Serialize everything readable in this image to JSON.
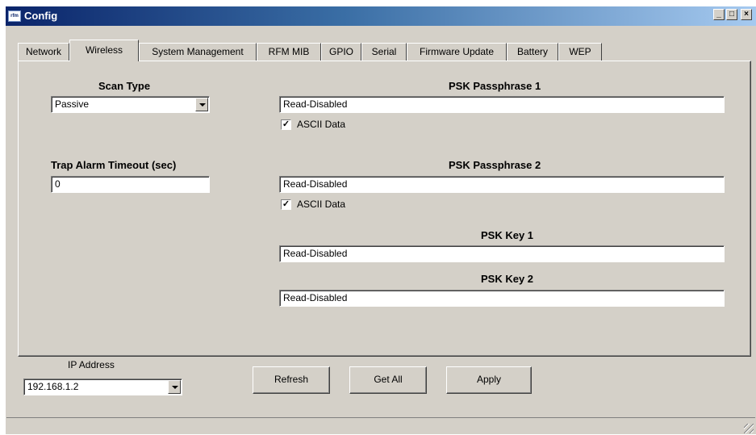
{
  "window": {
    "title": "Config",
    "icon_text": "rfm",
    "minimize_glyph": "_",
    "maximize_glyph": "□",
    "close_glyph": "×"
  },
  "tabs": [
    {
      "label": "Network",
      "active": false
    },
    {
      "label": "Wireless",
      "active": true
    },
    {
      "label": "System Management",
      "active": false
    },
    {
      "label": "RFM MIB",
      "active": false
    },
    {
      "label": "GPIO",
      "active": false
    },
    {
      "label": "Serial",
      "active": false
    },
    {
      "label": "Firmware Update",
      "active": false
    },
    {
      "label": "Battery",
      "active": false
    },
    {
      "label": "WEP",
      "active": false
    }
  ],
  "wireless": {
    "scan_type_label": "Scan Type",
    "scan_type_value": "Passive",
    "trap_alarm_label": "Trap Alarm Timeout (sec)",
    "trap_alarm_value": "0",
    "psk_passphrase_1_label": "PSK Passphrase 1",
    "psk_passphrase_1_value": "Read-Disabled",
    "ascii_data_1_label": "ASCII Data",
    "ascii_data_1_checked": true,
    "psk_passphrase_2_label": "PSK Passphrase 2",
    "psk_passphrase_2_value": "Read-Disabled",
    "ascii_data_2_label": "ASCII Data",
    "ascii_data_2_checked": true,
    "psk_key_1_label": "PSK Key 1",
    "psk_key_1_value": "Read-Disabled",
    "psk_key_2_label": "PSK Key 2",
    "psk_key_2_value": "Read-Disabled",
    "check_glyph": "✓"
  },
  "footer": {
    "ip_label": "IP Address",
    "ip_value": "192.168.1.2",
    "refresh_label": "Refresh",
    "get_all_label": "Get All",
    "apply_label": "Apply"
  },
  "colors": {
    "title_gradient_start": "#0a246a",
    "title_gradient_end": "#a6caf0",
    "face": "#d4d0c8"
  }
}
